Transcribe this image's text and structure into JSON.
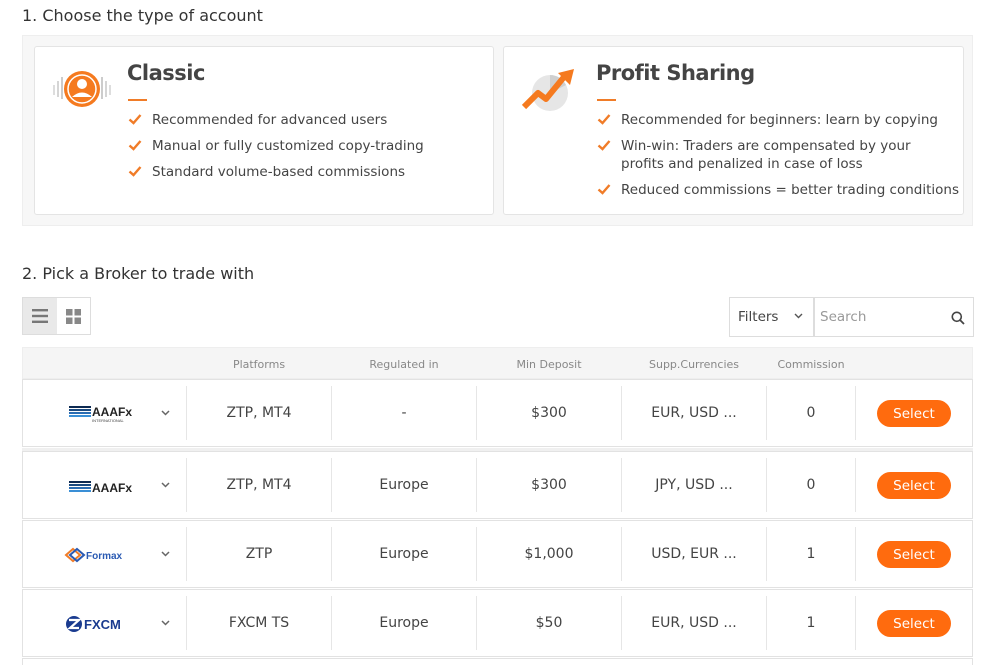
{
  "section1": {
    "title": "1. Choose the type of account"
  },
  "accounts": [
    {
      "title": "Classic",
      "icon": "user-circle-icon",
      "features": [
        "Recommended for advanced users",
        "Manual or fully customized copy-trading",
        "Standard volume-based commissions"
      ]
    },
    {
      "title": "Profit Sharing",
      "icon": "profit-chart-icon",
      "features": [
        "Recommended for beginners: learn by copying",
        "Win-win: Traders are compensated by your profits and penalized in case of loss",
        "Reduced commissions = better trading conditions"
      ]
    }
  ],
  "section2": {
    "title": "2. Pick a Broker to trade with"
  },
  "toolbar": {
    "filters_label": "Filters",
    "search_placeholder": "Search"
  },
  "table": {
    "headers": {
      "platforms": "Platforms",
      "regulated": "Regulated in",
      "min_deposit": "Min Deposit",
      "currencies": "Supp.Currencies",
      "commission": "Commission"
    },
    "rows": [
      {
        "broker": "AAAFx International",
        "logo_text": "AAAFx",
        "logo_sub": "INTERNATIONAL",
        "platforms": "ZTP, MT4",
        "regulated": "-",
        "min_deposit": "$300",
        "currencies": "EUR, USD ...",
        "commission": "0",
        "action": "Select"
      },
      {
        "broker": "AAAFx",
        "logo_text": "AAAFx",
        "logo_sub": "",
        "platforms": "ZTP, MT4",
        "regulated": "Europe",
        "min_deposit": "$300",
        "currencies": "JPY, USD ...",
        "commission": "0",
        "action": "Select"
      },
      {
        "broker": "Formax",
        "logo_text": "Formax",
        "logo_sub": "",
        "platforms": "ZTP",
        "regulated": "Europe",
        "min_deposit": "$1,000",
        "currencies": "USD, EUR ...",
        "commission": "1",
        "action": "Select"
      },
      {
        "broker": "FXCM",
        "logo_text": "FXCM",
        "logo_sub": "",
        "platforms": "FXCM TS",
        "regulated": "Europe",
        "min_deposit": "$50",
        "currencies": "EUR, USD ...",
        "commission": "1",
        "action": "Select"
      }
    ]
  },
  "colors": {
    "accent": "#ff6b0e",
    "check": "#f07c28",
    "header_bg": "#f5f5f5"
  }
}
